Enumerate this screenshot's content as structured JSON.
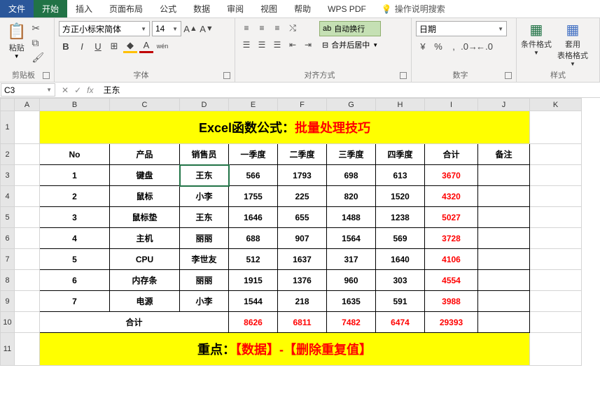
{
  "menu": {
    "file": "文件",
    "home": "开始",
    "insert": "插入",
    "layout": "页面布局",
    "formula": "公式",
    "data": "数据",
    "review": "审阅",
    "view": "视图",
    "help": "帮助",
    "wps": "WPS PDF",
    "search": "操作说明搜索"
  },
  "ribbon": {
    "clipboard": {
      "paste": "粘贴",
      "label": "剪贴板"
    },
    "font": {
      "name": "方正小标宋简体",
      "size": "14",
      "label": "字体",
      "bold": "B",
      "italic": "I",
      "underline": "U",
      "ruby": "wén"
    },
    "align": {
      "wrap": "自动换行",
      "merge": "合并后居中",
      "label": "对齐方式"
    },
    "number": {
      "format": "日期",
      "label": "数字"
    },
    "styles": {
      "cond": "条件格式",
      "table": "套用\n表格格式",
      "label": "样式"
    }
  },
  "namebox": "C3",
  "formula": "王东",
  "colHeaders": [
    "A",
    "B",
    "C",
    "D",
    "E",
    "F",
    "G",
    "H",
    "I",
    "J",
    "K"
  ],
  "rowHeaders": [
    "1",
    "2",
    "3",
    "4",
    "5",
    "6",
    "7",
    "8",
    "9",
    "10",
    "11"
  ],
  "banner1": {
    "black": "Excel函数公式：",
    "red": "批量处理技巧"
  },
  "banner2": {
    "black": "重点：",
    "red": "【数据】-【删除重复值】"
  },
  "headers": [
    "No",
    "产品",
    "销售员",
    "一季度",
    "二季度",
    "三季度",
    "四季度",
    "合计",
    "备注"
  ],
  "totalLabel": "合计",
  "rows": [
    {
      "no": "1",
      "prod": "键盘",
      "sales": "王东",
      "q1": "566",
      "q2": "1793",
      "q3": "698",
      "q4": "613",
      "sum": "3670"
    },
    {
      "no": "2",
      "prod": "鼠标",
      "sales": "小李",
      "q1": "1755",
      "q2": "225",
      "q3": "820",
      "q4": "1520",
      "sum": "4320"
    },
    {
      "no": "3",
      "prod": "鼠标垫",
      "sales": "王东",
      "q1": "1646",
      "q2": "655",
      "q3": "1488",
      "q4": "1238",
      "sum": "5027"
    },
    {
      "no": "4",
      "prod": "主机",
      "sales": "丽丽",
      "q1": "688",
      "q2": "907",
      "q3": "1564",
      "q4": "569",
      "sum": "3728"
    },
    {
      "no": "5",
      "prod": "CPU",
      "sales": "李世友",
      "q1": "512",
      "q2": "1637",
      "q3": "317",
      "q4": "1640",
      "sum": "4106"
    },
    {
      "no": "6",
      "prod": "内存条",
      "sales": "丽丽",
      "q1": "1915",
      "q2": "1376",
      "q3": "960",
      "q4": "303",
      "sum": "4554"
    },
    {
      "no": "7",
      "prod": "电源",
      "sales": "小李",
      "q1": "1544",
      "q2": "218",
      "q3": "1635",
      "q4": "591",
      "sum": "3988"
    }
  ],
  "totals": {
    "q1": "8626",
    "q2": "6811",
    "q3": "7482",
    "q4": "6474",
    "sum": "29393"
  },
  "chart_data": {
    "type": "table",
    "title": "Excel函数公式：批量处理技巧",
    "columns": [
      "No",
      "产品",
      "销售员",
      "一季度",
      "二季度",
      "三季度",
      "四季度",
      "合计",
      "备注"
    ],
    "data": [
      [
        1,
        "键盘",
        "王东",
        566,
        1793,
        698,
        613,
        3670,
        ""
      ],
      [
        2,
        "鼠标",
        "小李",
        1755,
        225,
        820,
        1520,
        4320,
        ""
      ],
      [
        3,
        "鼠标垫",
        "王东",
        1646,
        655,
        1488,
        1238,
        5027,
        ""
      ],
      [
        4,
        "主机",
        "丽丽",
        688,
        907,
        1564,
        569,
        3728,
        ""
      ],
      [
        5,
        "CPU",
        "李世友",
        512,
        1637,
        317,
        1640,
        4106,
        ""
      ],
      [
        6,
        "内存条",
        "丽丽",
        1915,
        1376,
        960,
        303,
        4554,
        ""
      ],
      [
        7,
        "电源",
        "小李",
        1544,
        218,
        1635,
        591,
        3988,
        ""
      ]
    ],
    "totals_row": [
      "合计",
      "",
      "",
      8626,
      6811,
      7482,
      6474,
      29393,
      ""
    ]
  }
}
